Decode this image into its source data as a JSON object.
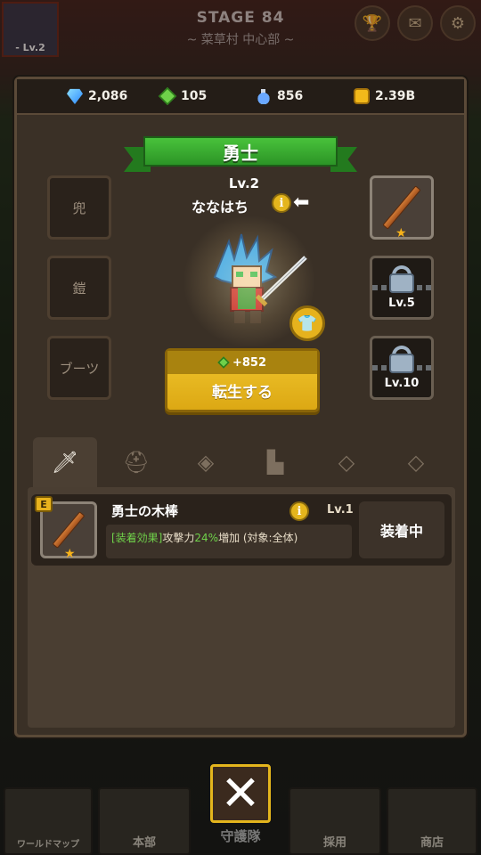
{
  "hud": {
    "stage_title": "STAGE 84",
    "stage_subtitle": "~ 菜草村 中心部 ~",
    "player_level": "- Lv.2"
  },
  "currency": {
    "diamonds": "2,086",
    "gems": "105",
    "potions": "856",
    "gold": "2.39B"
  },
  "hero": {
    "class_title": "勇士",
    "level": "Lv.2",
    "name": "ななはち",
    "info_icon": "i"
  },
  "slots": {
    "left": [
      "兜",
      "鎧",
      "ブーツ"
    ],
    "right_lock_1": "Lv.5",
    "right_lock_2": "Lv.10"
  },
  "reincarnate": {
    "cost": "+852",
    "label": "転生する"
  },
  "tabs": [
    {
      "icon": "sword-icon"
    },
    {
      "icon": "helmet-icon"
    },
    {
      "icon": "armor-icon"
    },
    {
      "icon": "boots-icon"
    },
    {
      "icon": "necklace-1-icon"
    },
    {
      "icon": "necklace-2-icon"
    }
  ],
  "item": {
    "badge": "E",
    "name": "勇士の木棒",
    "level": "Lv.1",
    "effect_tag": "[装着効果]",
    "effect_text_1": "攻撃力",
    "effect_value": "24%",
    "effect_text_2": "増加 (対象:全体)",
    "status_label": "装着中"
  },
  "bottom_nav": {
    "world_map": "ワールドマップ",
    "headquarters": "本部",
    "close_label": "守護隊",
    "recruit": "採用",
    "shop": "商店"
  }
}
